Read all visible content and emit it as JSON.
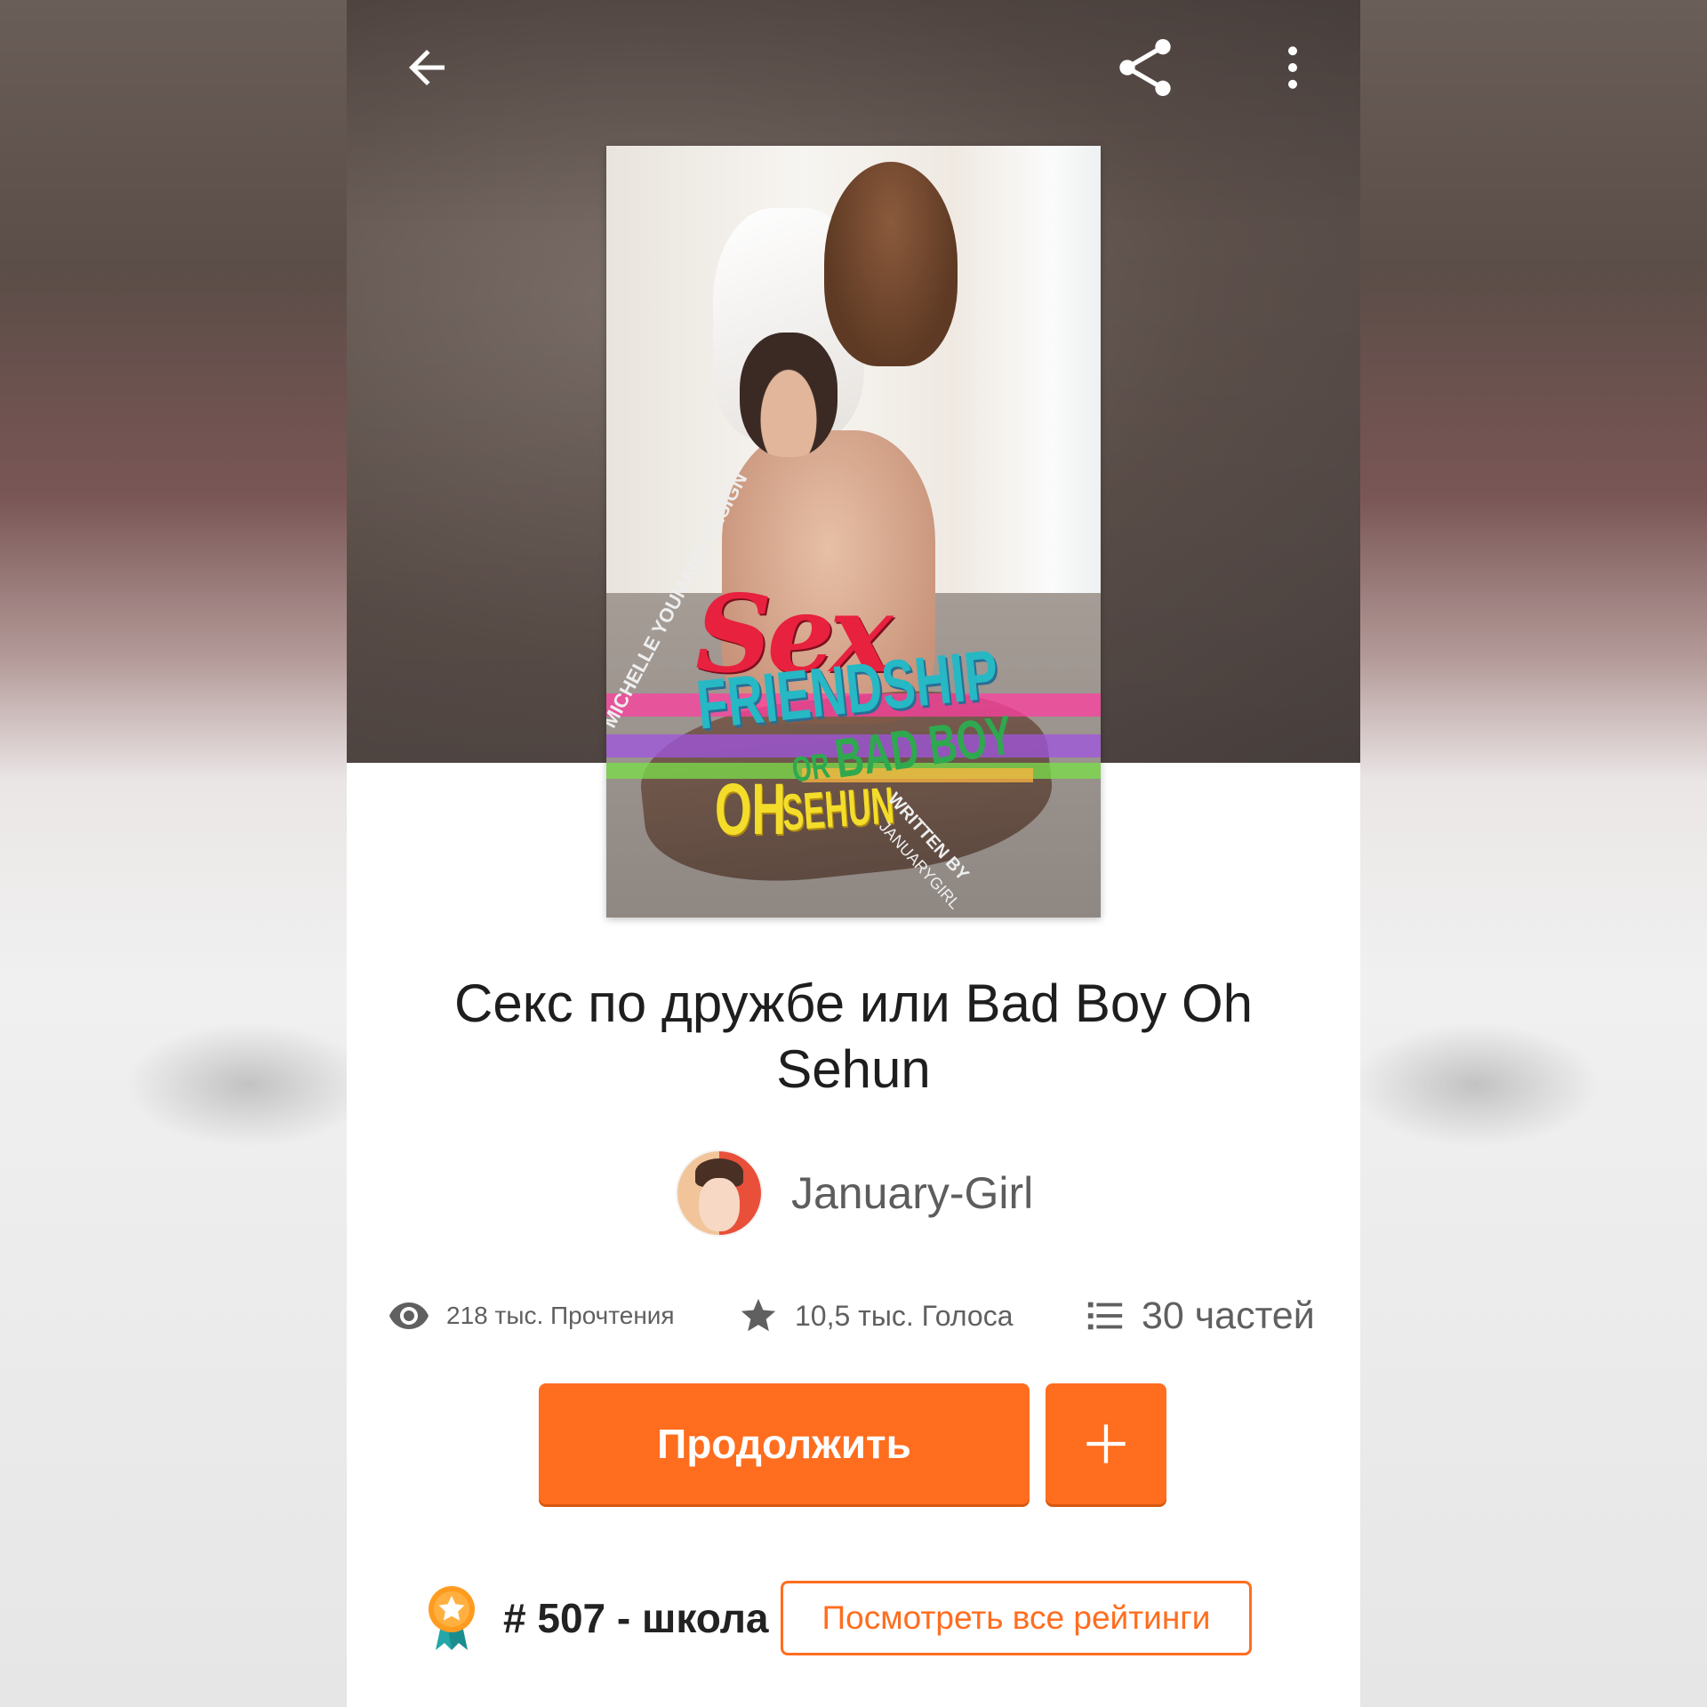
{
  "colors": {
    "accent": "#ff6d1f",
    "text_primary": "#1e1e1e",
    "text_secondary": "#606060",
    "header_background": "#5d504b"
  },
  "toolbar": {
    "back_icon": "arrow-left-icon",
    "share_icon": "share-icon",
    "more_icon": "more-vertical-icon"
  },
  "cover": {
    "title_word_1": "Sex",
    "title_word_2": "FRIENDSHIP",
    "title_or": "OR",
    "title_word_3": "BAD BOY",
    "name_1": "OH",
    "name_2": "SEHUN",
    "designer_credit": "MICHELLE YOUMANS DESIGN",
    "written_by": "WRITTEN BY",
    "author_credit": "JANUARYGIRL"
  },
  "story": {
    "title": "Секс по дружбе или Bad Boy Oh Sehun",
    "author": "January-Girl"
  },
  "stats": {
    "reads": "218 тыс. Прочтения",
    "votes": "10,5 тыс. Голоса",
    "parts": "30 частей"
  },
  "actions": {
    "continue_label": "Продолжить",
    "add_label": "+"
  },
  "ranking": {
    "text": "# 507 - школа",
    "view_all_label": "Посмотреть все рейтинги"
  }
}
